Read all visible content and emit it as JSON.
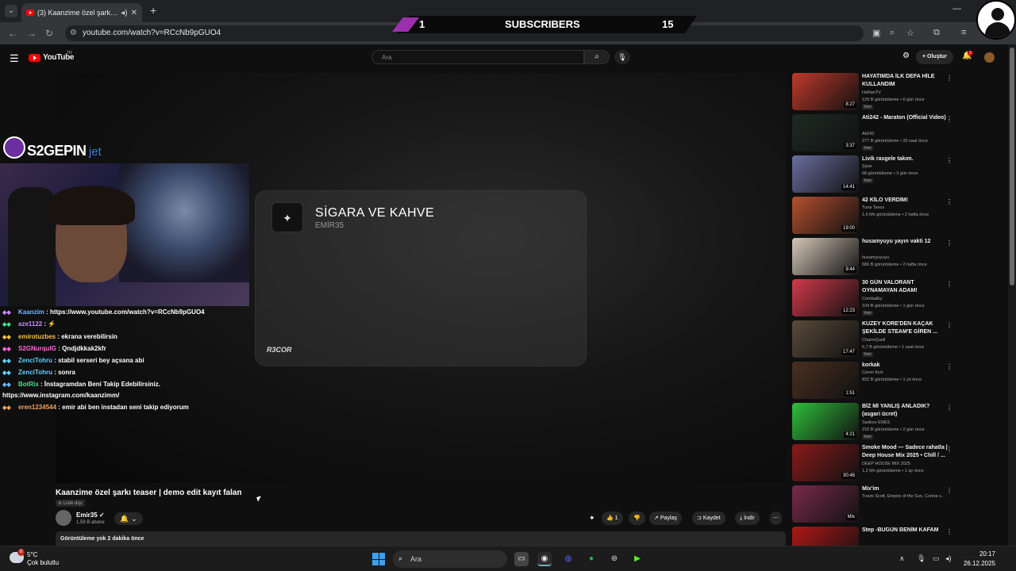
{
  "browser": {
    "tab_title": "(3) Kaanzime özel şarkı teas",
    "url": "youtube.com/watch?v=RCcNb9pGUO4"
  },
  "overlay": {
    "left_count": "1",
    "label": "SUBSCRIBERS",
    "right_count": "15"
  },
  "youtube": {
    "logo": "YouTube",
    "region": "TR",
    "search_placeholder": "Ara",
    "create_label": "Oluştur",
    "notif_count": "3"
  },
  "player": {
    "song_title": "SİGARA VE KAHVE",
    "song_artist": "EMİR35",
    "label": "R3COR"
  },
  "stream": {
    "brand": "S2GEPIN",
    "sponsor": "jet",
    "chat": [
      {
        "user": "Kaanzim",
        "color": "#6fb4ff",
        "msg": "https://www.youtube.com/watch?v=RCcNb9pGUO4"
      },
      {
        "user": "aze1122",
        "color": "#c58af9",
        "msg": "⚡"
      },
      {
        "user": "emirotuzbes",
        "color": "#f5c04a",
        "msg": "ekrana verebilirsin"
      },
      {
        "user": "S2GNurquIG",
        "color": "#ff69d4",
        "msg": "Qndjdkkak2kfr"
      },
      {
        "user": "ZenciTohru",
        "color": "#62d0ff",
        "msg": "stabil serseri bey açsana abi"
      },
      {
        "user": "ZenciTohru",
        "color": "#62d0ff",
        "msg": "sonra"
      },
      {
        "user": "BotRix",
        "color": "#46e08b",
        "msg": "İnstagramdan Beni Takip Edebilirsiniz. https://www.instagram.com/kaanzimm/"
      },
      {
        "user": "eren1234544",
        "color": "#f0a35e",
        "msg": "emir abi ben instadan seni takip ediyorum"
      }
    ]
  },
  "video": {
    "title": "Kaanzime özel şarkı teaser | demo edit kayıt falan",
    "visibility": "Liste dışı",
    "channel": "Emir35",
    "subscribers": "1,59 B abone",
    "likes": "1",
    "share": "Paylaş",
    "save": "Kaydet",
    "download": "İndir",
    "desc": "Görüntüleme yok  2 dakika önce"
  },
  "recommendations": [
    {
      "title": "HAYATIMDA İLK DEFA HİLE KULLANDIM",
      "channel": "HellianTV",
      "meta": "129 B görüntüleme • 6 gün önce",
      "duration": "8:27",
      "new": "Yeni",
      "color": "#c0392b"
    },
    {
      "title": "Ati242 - Maraton (Official Video)",
      "channel": "Ati242",
      "meta": "277 B görüntüleme • 20 saat önce",
      "duration": "3:37",
      "new": "Yeni",
      "color": "#1d2a24"
    },
    {
      "title": "Livik rasgele takım.",
      "channel": "Şiyar",
      "meta": "68 görüntüleme • 3 gün önce",
      "duration": "14:41",
      "new": "Yeni",
      "color": "#6a6fa0"
    },
    {
      "title": "42 KİLO VERDİM!",
      "channel": "Tuna Tavus",
      "meta": "1,6 Mn görüntüleme • 2 hafta önce",
      "duration": "19:00",
      "new": "",
      "color": "#b5502e"
    },
    {
      "title": "husamyuyu yayın vakti 12",
      "channel": "husamyuyuyu",
      "meta": "686 B görüntüleme • 2 hafta önce",
      "duration": "9:44",
      "new": "",
      "color": "#d6c8b8"
    },
    {
      "title": "30 GÜN VALORANT OYNAMAYAN ADAM!",
      "channel": "CombatEy",
      "meta": "104 B görüntüleme • 1 gün önce",
      "duration": "12:23",
      "new": "Yeni",
      "color": "#d23a4a"
    },
    {
      "title": "KUZEY KORE'DEN KAÇAK ŞEKİLDE STEAM'E GİREN ...",
      "channel": "CharmQuell",
      "meta": "5,7 B görüntüleme • 1 saat önce",
      "duration": "17:47",
      "new": "Yeni",
      "color": "#5a4a3a"
    },
    {
      "title": "korkak",
      "channel": "Ceren Kurt",
      "meta": "832 B görüntüleme • 1 yıl önce",
      "duration": "1:51",
      "new": "",
      "color": "#4a3020"
    },
    {
      "title": "BİZ Mİ YANLIŞ ANLADIK? (asgari ücret)",
      "channel": "Sadece ENES",
      "meta": "216 B görüntüleme • 2 gün önce",
      "duration": "4:21",
      "new": "Yeni",
      "color": "#2fbf3a"
    },
    {
      "title": "Smoke Mood — Sadece rahatla | Deep House Mix 2025 • Chill / ...",
      "channel": "DEEP HOUSE MIX 2025",
      "meta": "1,2 Mn görüntüleme • 1 ay önce",
      "duration": "30:46",
      "new": "",
      "color": "#8a1a1a"
    },
    {
      "title": "Mix'im",
      "channel": "Travis Scott, Empire of the Sun, Contra v...",
      "meta": "",
      "duration": "Mix",
      "new": "",
      "color": "#7a2a4a"
    },
    {
      "title": "Step -BUGÜN BENİM KAFAM",
      "channel": "",
      "meta": "",
      "duration": "",
      "new": "",
      "color": "#b01818"
    }
  ],
  "taskbar": {
    "temp": "5°C",
    "weather": "Çok bulutlu",
    "weather_badge": "8",
    "search": "Ara",
    "time": "20:17",
    "date": "26.12.2025"
  }
}
